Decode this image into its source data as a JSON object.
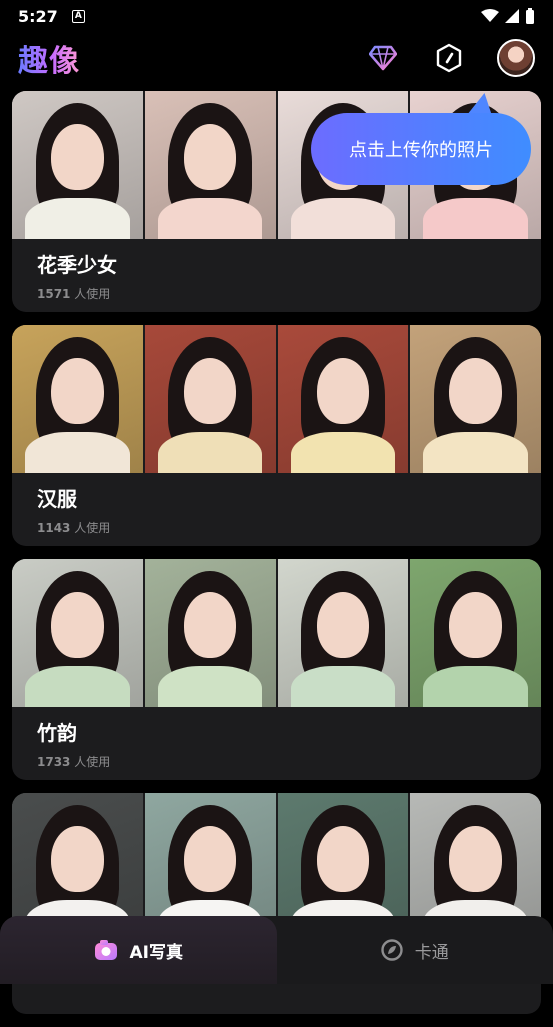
{
  "status_bar": {
    "time": "5:27",
    "notification_letter": "A"
  },
  "header": {
    "app_title": "趣像"
  },
  "tooltip": {
    "text": "点击上传你的照片"
  },
  "cards": [
    {
      "title": "花季少女",
      "usage_count": "1571",
      "usage_suffix": " 人使用",
      "thumb_bg": [
        "#cfc8c4",
        "#d9c0b7",
        "#e9dcd9",
        "#e8d2d0"
      ],
      "thumb_body": [
        "#f0efe6",
        "#f3d6cd",
        "#f2dfd9",
        "#f5c9c9"
      ]
    },
    {
      "title": "汉服",
      "usage_count": "1143",
      "usage_suffix": " 人使用",
      "thumb_bg": [
        "#c7a35b",
        "#a7493a",
        "#a94a3b",
        "#c3a27a"
      ],
      "thumb_body": [
        "#f1e6d7",
        "#efdfb7",
        "#f2e3b0",
        "#f3e4c3"
      ]
    },
    {
      "title": "竹韵",
      "usage_count": "1733",
      "usage_suffix": " 人使用",
      "thumb_bg": [
        "#c9ccc5",
        "#a3b29a",
        "#d2d6cd",
        "#7ea66e"
      ],
      "thumb_body": [
        "#c6dcc0",
        "#cfe2c5",
        "#c9dec7",
        "#b3d3ac"
      ]
    },
    {
      "title": "",
      "usage_count": "",
      "usage_suffix": "",
      "thumb_bg": [
        "#4a4d4d",
        "#8fa7a0",
        "#5d7a6e",
        "#b7b9b6"
      ],
      "thumb_body": [
        "#f3f1ef",
        "#f6f5f3",
        "#f4f2ef",
        "#f1efec"
      ]
    }
  ],
  "bottom_nav": {
    "tabs": [
      {
        "label": "AI写真",
        "icon": "camera-icon",
        "active": true
      },
      {
        "label": "卡通",
        "icon": "cartoon-icon",
        "active": false
      }
    ]
  },
  "colors": {
    "accent_gradient_start": "#6c6cff",
    "accent_gradient_end": "#3f8dff",
    "card_bg": "#1c1c1e"
  }
}
